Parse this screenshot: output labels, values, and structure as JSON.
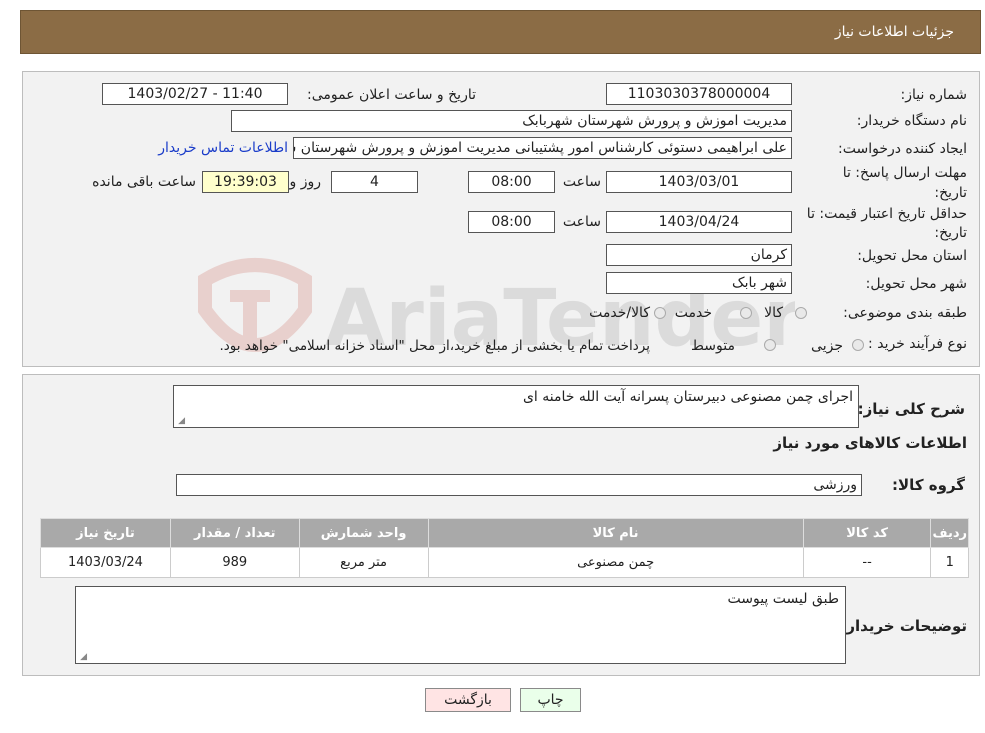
{
  "header": {
    "title": "جزئیات اطلاعات نیاز"
  },
  "form": {
    "need_number_label": "شماره نیاز:",
    "need_number": "1103030378000004",
    "announce_label": "تاریخ و ساعت اعلان عمومی:",
    "announce_value": "1403/02/27 - 11:40",
    "buyer_org_label": "نام دستگاه خریدار:",
    "buyer_org": "مدیریت اموزش و پرورش شهرستان شهربابک",
    "requester_label": "ایجاد کننده درخواست:",
    "requester": "علی  ابراهیمی دستوئی  کارشناس امور پشتیبانی  مدیریت اموزش و پرورش شهرستان شهربابک",
    "contact_link": "اطلاعات تماس خریدار",
    "deadline_label_1": "مهلت ارسال پاسخ: تا",
    "deadline_label_2": "تاریخ:",
    "deadline_date": "1403/03/01",
    "hour_label": "ساعت",
    "deadline_time": "08:00",
    "days_value": "4",
    "day_and_label": "روز و",
    "remaining_time": "19:39:03",
    "remaining_label": "ساعت باقی مانده",
    "validity_label_1": "حداقل تاریخ اعتبار قیمت: تا",
    "validity_label_2": "تاریخ:",
    "validity_date": "1403/04/24",
    "validity_time": "08:00",
    "province_label": "استان محل تحویل:",
    "province": "کرمان",
    "city_label": "شهر محل تحویل:",
    "city": "شهر بابک",
    "category_label": "طبقه بندی موضوعی:",
    "category_options": [
      "کالا",
      "خدمت",
      "کالا/خدمت"
    ],
    "process_label": "نوع فرآیند خرید :",
    "process_options": [
      "جزیی",
      "متوسط"
    ],
    "process_note": "پرداخت تمام یا بخشی از مبلغ خرید،از محل \"اسناد خزانه اسلامی\" خواهد بود."
  },
  "details": {
    "summary_label": "شرح کلی نیاز:",
    "summary": "اجرای چمن مصنوعی دبیرستان پسرانه آیت الله خامنه ای",
    "goods_title": "اطلاعات کالاهای مورد نیاز",
    "group_label": "گروه کالا:",
    "group": "ورزشی",
    "table": {
      "headers": [
        "ردیف",
        "کد کالا",
        "نام کالا",
        "واحد شمارش",
        "تعداد / مقدار",
        "تاریخ نیاز"
      ],
      "rows": [
        [
          "1",
          "--",
          "چمن مصنوعی",
          "متر مربع",
          "989",
          "1403/03/24"
        ]
      ]
    },
    "buyer_notes_label": "توضیحات خریدار:",
    "buyer_notes": "طبق لیست پیوست"
  },
  "buttons": {
    "print": "چاپ",
    "back": "بازگشت"
  },
  "colors": {
    "header": "#8b6c45",
    "print_btn": "#eaffea",
    "back_btn": "#ffe4e4"
  }
}
